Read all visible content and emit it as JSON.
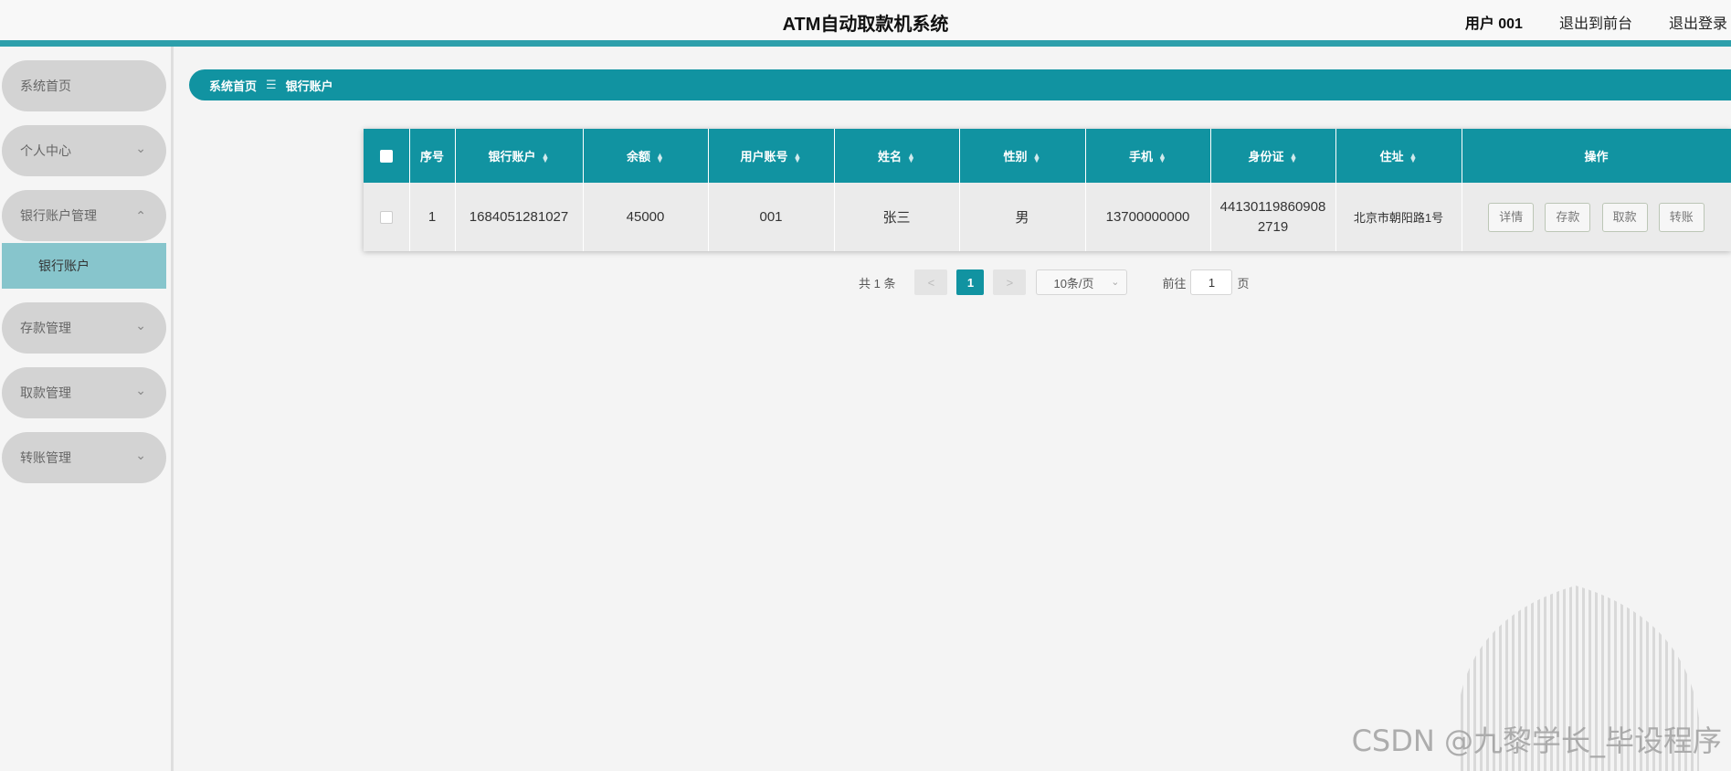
{
  "header": {
    "title": "ATM自动取款机系统",
    "user": "用户 001",
    "to_front": "退出到前台",
    "logout": "退出登录"
  },
  "sidebar": {
    "items": [
      {
        "label": "系统首页"
      },
      {
        "label": "个人中心"
      },
      {
        "label": "银行账户管理"
      },
      {
        "label": "存款管理"
      },
      {
        "label": "取款管理"
      },
      {
        "label": "转账管理"
      }
    ],
    "sub_item": "银行账户"
  },
  "breadcrumb": {
    "home": "系统首页",
    "sep": "☰",
    "current": "银行账户"
  },
  "table": {
    "headers": [
      "序号",
      "银行账户",
      "余额",
      "用户账号",
      "姓名",
      "性别",
      "手机",
      "身份证",
      "住址",
      "操作"
    ],
    "rows": [
      {
        "index": "1",
        "account": "1684051281027",
        "balance": "45000",
        "user_account": "001",
        "name": "张三",
        "gender": "男",
        "phone": "13700000000",
        "id_card": "441301198609082719",
        "address": "北京市朝阳路1号"
      }
    ],
    "actions": [
      "详情",
      "存款",
      "取款",
      "转账"
    ]
  },
  "pagination": {
    "total": "共 1 条",
    "prev": "<",
    "current_page": "1",
    "next": ">",
    "page_size": "10条/页",
    "goto_label": "前往",
    "goto_value": "1",
    "page_suffix": "页"
  },
  "watermark": "CSDN @九黎学长_毕设程序"
}
